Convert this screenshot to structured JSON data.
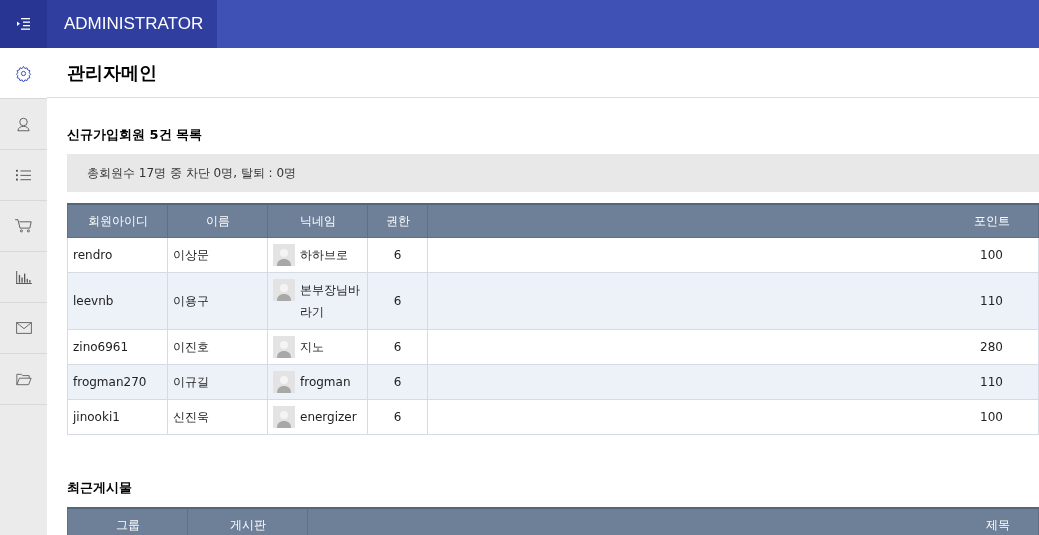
{
  "header": {
    "title": "ADMINISTRATOR"
  },
  "sidebar": {
    "items": [
      {
        "kind": "gear",
        "selected": true
      },
      {
        "kind": "user",
        "selected": false
      },
      {
        "kind": "list",
        "selected": false
      },
      {
        "kind": "cart",
        "selected": false
      },
      {
        "kind": "chart",
        "selected": false
      },
      {
        "kind": "mail",
        "selected": false
      },
      {
        "kind": "folder",
        "selected": false
      }
    ]
  },
  "page_title": "관리자메인",
  "members": {
    "title": "신규가입회원 5건 목록",
    "summary": "총회원수 17명 중 차단 0명, 탈퇴 : 0명",
    "columns": [
      "회원아이디",
      "이름",
      "닉네임",
      "권한",
      "포인트"
    ],
    "rows": [
      {
        "id": "rendro",
        "name": "이상문",
        "nickname": "하하브로",
        "level": "6",
        "points": "100"
      },
      {
        "id": "leevnb",
        "name": "이용구",
        "nickname": "본부장님바라기",
        "level": "6",
        "points": "110"
      },
      {
        "id": "zino6961",
        "name": "이진호",
        "nickname": "지노",
        "level": "6",
        "points": "280"
      },
      {
        "id": "frogman270",
        "name": "이규길",
        "nickname": "frogman",
        "level": "6",
        "points": "110"
      },
      {
        "id": "jinooki1",
        "name": "신진욱",
        "nickname": "energizer",
        "level": "6",
        "points": "100"
      }
    ]
  },
  "posts": {
    "title": "최근게시물",
    "columns": [
      "그룹",
      "게시판",
      "제목"
    ]
  }
}
